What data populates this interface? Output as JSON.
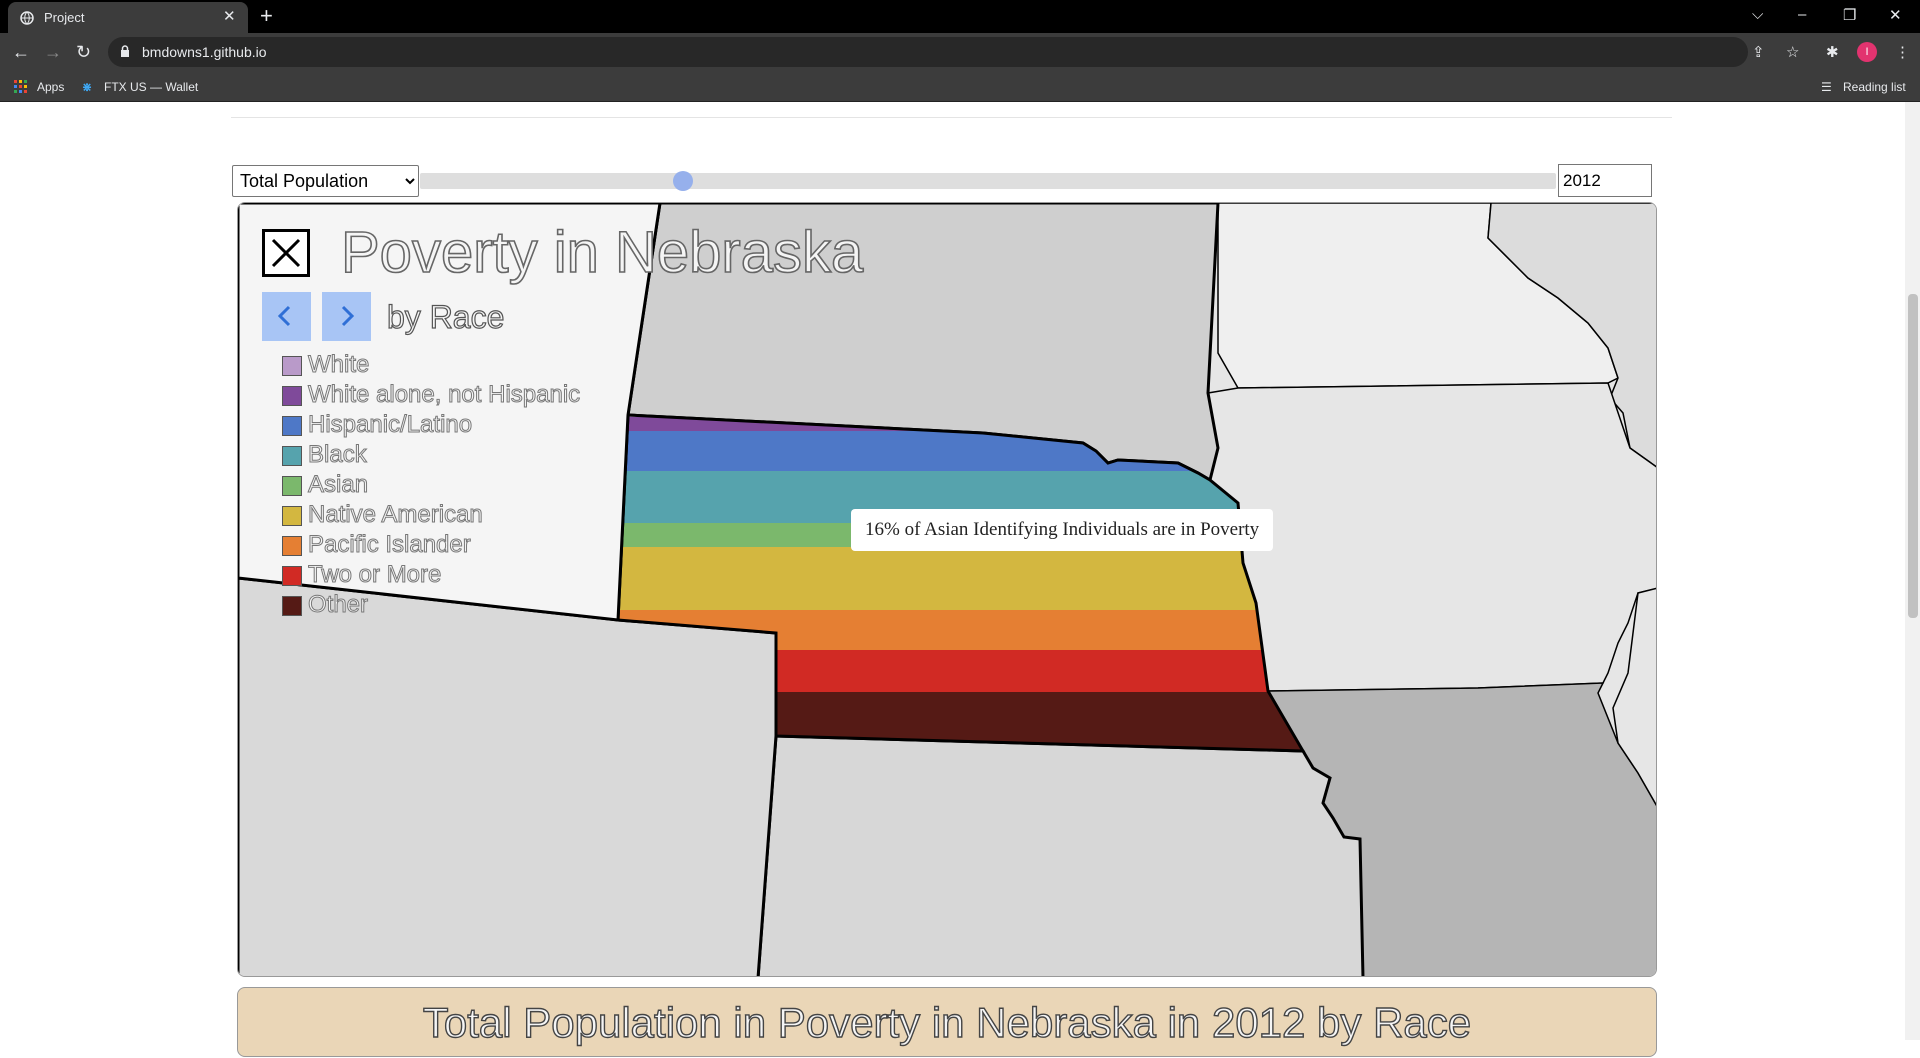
{
  "browser": {
    "tab_title": "Project",
    "tab_close": "✕",
    "new_tab": "+",
    "url": "bmdowns1.github.io",
    "profile_initial": "I",
    "bookmarks": [
      {
        "label": "Apps",
        "icon": "apps-grid-icon"
      },
      {
        "label": "FTX US — Wallet",
        "icon": "ftx-icon"
      }
    ],
    "reading_list": "Reading list",
    "window_controls": {
      "tabs_menu": "⌵",
      "minimize": "–",
      "restore": "❐",
      "close": "✕"
    }
  },
  "controls": {
    "metric_selected": "Total Population",
    "metric_options": [
      "Total Population"
    ],
    "year_value": "2012",
    "year_slider_fraction": 0.227
  },
  "map": {
    "title": "Poverty in Nebraska",
    "subtitle": "by Race",
    "tooltip": "16% of Asian Identifying Individuals are in Poverty",
    "legend": [
      {
        "label": "White",
        "color": "#b99ac9"
      },
      {
        "label": "White alone, not Hispanic",
        "color": "#7f4a9a"
      },
      {
        "label": "Hispanic/Latino",
        "color": "#4e78c7"
      },
      {
        "label": "Black",
        "color": "#56a3ad"
      },
      {
        "label": "Asian",
        "color": "#7bb86c"
      },
      {
        "label": "Native American",
        "color": "#d3b740"
      },
      {
        "label": "Pacific Islander",
        "color": "#e57f33"
      },
      {
        "label": "Two or More",
        "color": "#d12a24"
      },
      {
        "label": "Other",
        "color": "#551a15"
      }
    ],
    "colors": {
      "legend_panel": "#f5f5f5",
      "sd": "#cfcfcf",
      "mn": "#efefef",
      "wi": "#dcdcdc",
      "ia": "#e6e6e6",
      "mo": "#b5b5b5",
      "ks": "#d7d7d7",
      "co": "#d9d9d9",
      "pager": "#a8c5f5",
      "pager_arrow": "#2f6fd6"
    }
  },
  "banner": {
    "title": "Total Population in Poverty in Nebraska in 2012 by Race",
    "color": "#ead6b7"
  }
}
